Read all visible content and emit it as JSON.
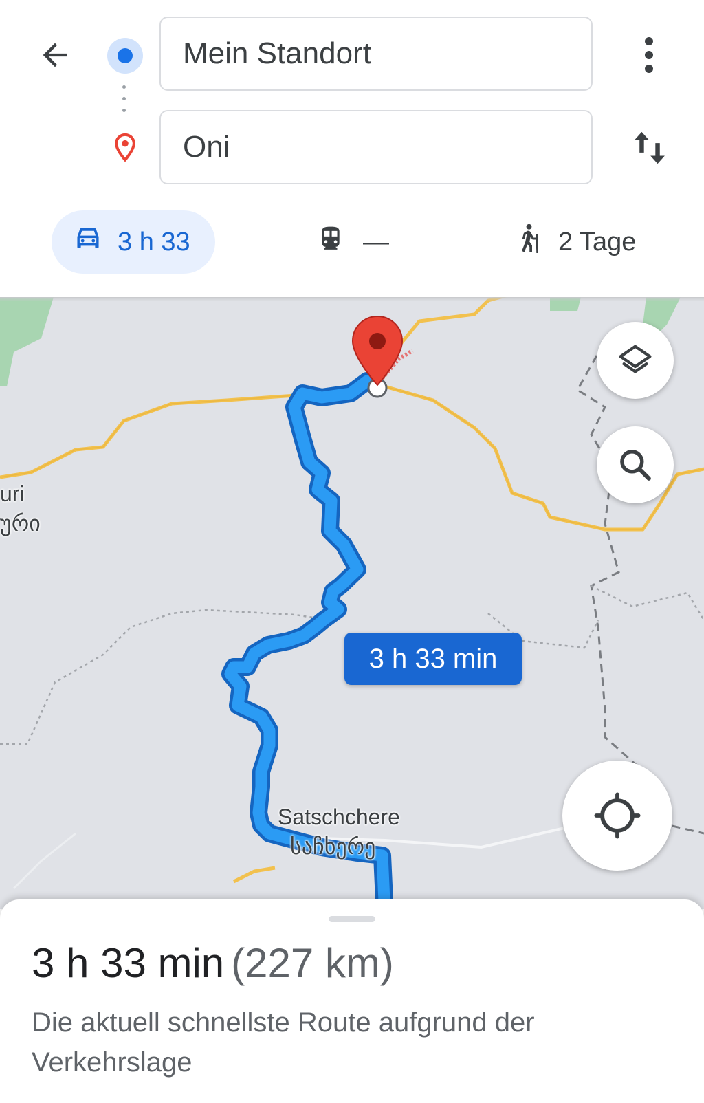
{
  "search": {
    "origin_value": "Mein Standort",
    "destination_value": "Oni"
  },
  "icons": {
    "back": "arrow-back-icon",
    "origin": "my-location-dot-icon",
    "destination": "place-pin-icon",
    "more": "more-vert-icon",
    "swap": "swap-vert-icon",
    "car": "car-icon",
    "transit": "train-icon",
    "walk": "hiking-icon",
    "layers": "layers-icon",
    "search": "search-icon",
    "locate": "my-location-icon"
  },
  "travel_modes": {
    "car_label": "3 h 33",
    "transit_label": "—",
    "walk_label": "2 Tage",
    "selected": "car"
  },
  "map": {
    "route_time_label": "3 h 33 min",
    "labels": {
      "west_town_latin": "uri",
      "west_town_georgian": "ური",
      "town_latin": "Satschchere",
      "town_georgian": "საჩხერე"
    },
    "colors": {
      "route": "#2b9bf4",
      "route_border": "#1565c0",
      "road": "#f2c14e",
      "pin": "#ea4335",
      "land": "#e0e2e7",
      "park": "#a8d5b1"
    }
  },
  "summary": {
    "duration": "3 h 33 min",
    "distance": "(227 km)",
    "description": "Die aktuell schnellste Route aufgrund der Verkehrslage"
  }
}
